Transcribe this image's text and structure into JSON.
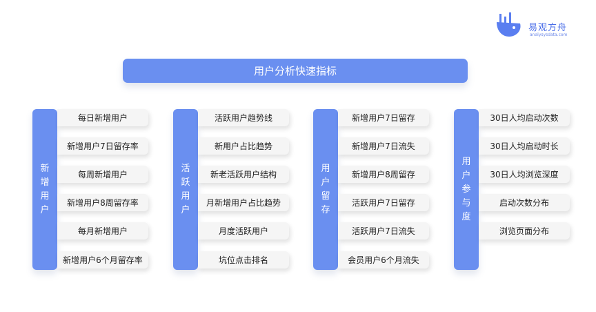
{
  "logo": {
    "name": "易观方舟",
    "sub": "analysysdata.com"
  },
  "title": "用户分析快速指标",
  "groups": [
    {
      "label": [
        "新",
        "增",
        "用",
        "户"
      ],
      "items": [
        "每日新增用户",
        "新增用户7日留存率",
        "每周新增用户",
        "新增用户8周留存率",
        "每月新增用户",
        "新增用户6个月留存率"
      ]
    },
    {
      "label": [
        "活",
        "跃",
        "用",
        "户"
      ],
      "items": [
        "活跃用户趋势线",
        "新用户占比趋势",
        "新老活跃用户结构",
        "月新增用户占比趋势",
        "月度活跃用户",
        "坑位点击排名"
      ]
    },
    {
      "label": [
        "用",
        "户",
        "留",
        "存"
      ],
      "items": [
        "新增用户7日留存",
        "新增用户7日流失",
        "新增用户8周留存",
        "活跃用户7日留存",
        "活跃用户7日流失",
        "会员用户6个月流失"
      ]
    },
    {
      "label": [
        "用",
        "户",
        "参",
        "与",
        "度"
      ],
      "items": [
        "30日人均启动次数",
        "30日人均启动时长",
        "30日人均浏览深度",
        "启动次数分布",
        "浏览页面分布"
      ]
    }
  ]
}
